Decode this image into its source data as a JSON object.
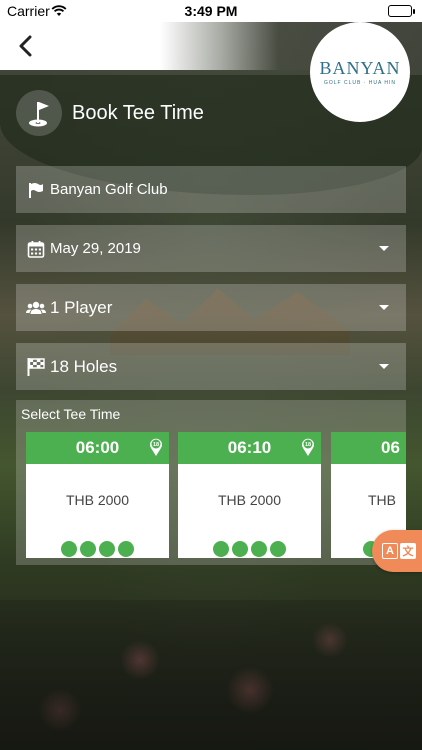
{
  "status_bar": {
    "carrier": "Carrier",
    "time": "3:49 PM"
  },
  "nav": {
    "back_icon": "chevron-left-icon"
  },
  "logo": {
    "title": "BANYAN",
    "subtitle": "GOLF CLUB · HUA HIN"
  },
  "header": {
    "title": "Book Tee Time",
    "icon": "golf-flag-icon"
  },
  "fields": {
    "club": {
      "value": "Banyan Golf Club",
      "icon": "flag-icon"
    },
    "date": {
      "value": "May 29, 2019",
      "icon": "calendar-icon"
    },
    "players": {
      "value": "1 Player",
      "icon": "users-icon"
    },
    "holes": {
      "value": "18 Holes",
      "icon": "checkered-flag-icon"
    }
  },
  "tee_section": {
    "label": "Select Tee Time",
    "slots": [
      {
        "time": "06:00",
        "holes_badge": "18",
        "price": "THB 2000",
        "player_dots": 4
      },
      {
        "time": "06:10",
        "holes_badge": "18",
        "price": "THB 2000",
        "player_dots": 4
      },
      {
        "time": "06",
        "holes_badge": "",
        "price": "THB",
        "player_dots": 2
      }
    ]
  },
  "colors": {
    "accent_green": "#4cb050",
    "translate_orange": "#f08a58",
    "logo_blue": "#2f6f8a"
  }
}
